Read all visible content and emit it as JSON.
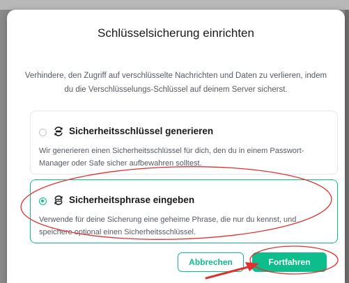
{
  "dialog": {
    "title": "Schlüsselsicherung einrichten",
    "description": "Verhindere, den Zugriff auf verschlüsselte Nachrichten und Daten zu verlieren, indem du die Verschlüsselungs-Schlüssel auf deinem Server sicherst."
  },
  "options": [
    {
      "title": "Sicherheitsschlüssel generieren",
      "description": "Wir generieren einen Sicherheitsschlüssel für dich, den du in einem Passwort-Manager oder Safe sicher aufbewahren solltest.",
      "selected": false,
      "icon": "key-sync-icon"
    },
    {
      "title": "Sicherheitsphrase eingeben",
      "description": "Verwende für deine Sicherung eine geheime Phrase, die nur du kennst, und speichere optional einen Sicherheitsschlüssel.",
      "selected": true,
      "icon": "passphrase-icon"
    }
  ],
  "buttons": {
    "cancel": "Abbrechen",
    "continue": "Fortfahren"
  },
  "colors": {
    "accent": "#0dbd8b",
    "annotation": "#e0302f"
  }
}
